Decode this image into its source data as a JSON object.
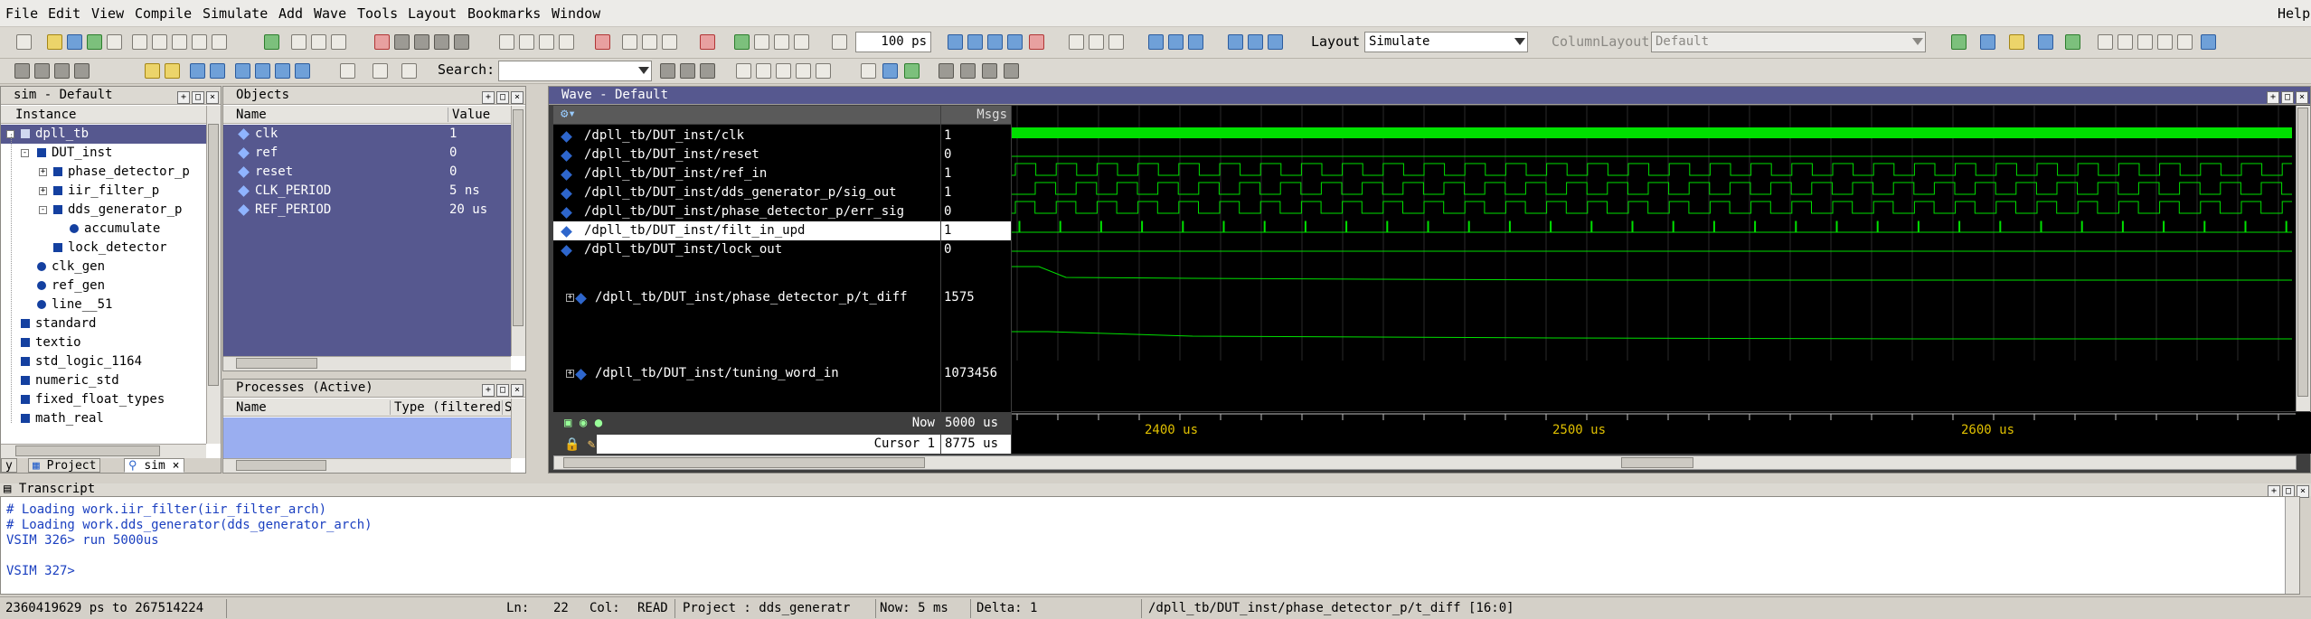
{
  "menu": {
    "items": [
      "File",
      "Edit",
      "View",
      "Compile",
      "Simulate",
      "Add",
      "Wave",
      "Tools",
      "Layout",
      "Bookmarks",
      "Window"
    ],
    "help": "Help"
  },
  "toolbar": {
    "runtime": "100 ps",
    "layout_label": "Layout",
    "layout_value": "Simulate",
    "column_layout_label": "ColumnLayout",
    "column_layout_value": "Default",
    "search_label": "Search:",
    "search_value": ""
  },
  "sim_pane": {
    "title": "sim - Default",
    "col_instance": "Instance",
    "tree": [
      "dpll_tb",
      "DUT_inst",
      "phase_detector_p",
      "iir_filter_p",
      "dds_generator_p",
      "accumulate",
      "lock_detector",
      "clk_gen",
      "ref_gen",
      "line__51",
      "standard",
      "textio",
      "std_logic_1164",
      "numeric_std",
      "fixed_float_types",
      "math_real"
    ],
    "tabs": [
      "y",
      "Project",
      "sim"
    ]
  },
  "objects_pane": {
    "title": "Objects",
    "col_name": "Name",
    "col_value": "Value",
    "rows": [
      {
        "name": "clk",
        "value": "1"
      },
      {
        "name": "ref",
        "value": "0"
      },
      {
        "name": "reset",
        "value": "0"
      },
      {
        "name": "CLK_PERIOD",
        "value": "5 ns"
      },
      {
        "name": "REF_PERIOD",
        "value": "20 us"
      }
    ]
  },
  "processes_pane": {
    "title": "Processes (Active)",
    "col_name": "Name",
    "col_type": "Type (filtered",
    "col_state": "St"
  },
  "wave_pane": {
    "title": "Wave - Default",
    "msgs_header": "Msgs",
    "signals": [
      {
        "name": "/dpll_tb/DUT_inst/clk",
        "value": "1"
      },
      {
        "name": "/dpll_tb/DUT_inst/reset",
        "value": "0"
      },
      {
        "name": "/dpll_tb/DUT_inst/ref_in",
        "value": "1"
      },
      {
        "name": "/dpll_tb/DUT_inst/dds_generator_p/sig_out",
        "value": "1"
      },
      {
        "name": "/dpll_tb/DUT_inst/phase_detector_p/err_sig",
        "value": "0"
      },
      {
        "name": "/dpll_tb/DUT_inst/filt_in_upd",
        "value": "1"
      },
      {
        "name": "/dpll_tb/DUT_inst/lock_out",
        "value": "0"
      },
      {
        "name": "/dpll_tb/DUT_inst/phase_detector_p/t_diff",
        "value": "1575"
      },
      {
        "name": "/dpll_tb/DUT_inst/tuning_word_in",
        "value": "1073456"
      }
    ],
    "now_label": "Now",
    "now_value": "5000 us",
    "cursor_label": "Cursor 1",
    "cursor_value": "8775 us",
    "time_ticks": [
      "2400 us",
      "2500 us",
      "2600 us"
    ]
  },
  "transcript": {
    "title": "Transcript",
    "lines": [
      "# Loading work.iir_filter(iir_filter_arch)",
      "# Loading work.dds_generator(dds_generator_arch)",
      "VSIM 326> run 5000us",
      "",
      "VSIM 327>"
    ]
  },
  "status": {
    "range": "2360419629 ps to 267514224",
    "ln_label": "Ln:",
    "ln_value": "22",
    "col_label": "Col:",
    "col_value": "READ",
    "project": "Project : dds_generatr",
    "now": "Now: 5 ms",
    "delta": "Delta: 1",
    "path": "/dpll_tb/DUT_inst/phase_detector_p/t_diff [16:0]"
  },
  "colors": {
    "wave_green": "#00e000",
    "selection": "#56588f",
    "signal_bg": "#000000"
  }
}
